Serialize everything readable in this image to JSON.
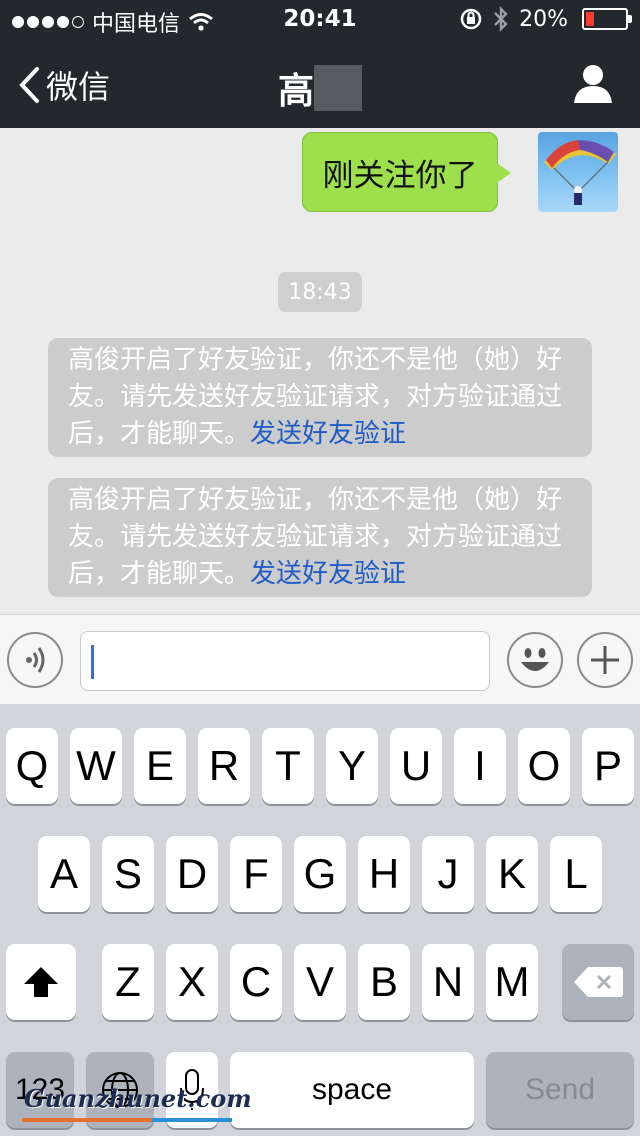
{
  "status_bar": {
    "carrier": "中国电信",
    "time": "20:41",
    "battery_text": "20%",
    "battery_level": 0.2,
    "signal_dots_filled": 4,
    "signal_dots_total": 5,
    "battery_color": "#ff3b30"
  },
  "nav": {
    "back_label": "微信",
    "title": "高",
    "back_icon": "chevron-left-icon",
    "profile_icon": "person-icon",
    "bar_color": "#22282b"
  },
  "chat": {
    "outgoing_message": "刚关注你了",
    "outgoing_color": "#9ee04c",
    "timestamp": "18:43",
    "system_messages": [
      {
        "text": "高俊开启了好友验证，你还不是他（她）好友。请先发送好友验证请求，对方验证通过后，才能聊天。",
        "link": "发送好友验证"
      },
      {
        "text": "高俊开启了好友验证，你还不是他（她）好友。请先发送好友验证请求，对方验证通过后，才能聊天。",
        "link": "发送好友验证"
      }
    ],
    "link_color": "#1f5cc7"
  },
  "input_bar": {
    "voice_icon": "voice-icon",
    "emoji_icon": "smiley-icon",
    "plus_icon": "plus-icon",
    "text_value": ""
  },
  "keyboard": {
    "row1": [
      "Q",
      "W",
      "E",
      "R",
      "T",
      "Y",
      "U",
      "I",
      "O",
      "P"
    ],
    "row2": [
      "A",
      "S",
      "D",
      "F",
      "G",
      "H",
      "J",
      "K",
      "L"
    ],
    "row3": [
      "Z",
      "X",
      "C",
      "V",
      "B",
      "N",
      "M"
    ],
    "shift_icon": "shift-icon",
    "delete_icon": "backspace-icon",
    "numbers_label": "123",
    "globe_icon": "globe-icon",
    "mic_icon": "microphone-icon",
    "space_label": "space",
    "send_label": "Send"
  },
  "watermark": "Guanzhunet.com"
}
